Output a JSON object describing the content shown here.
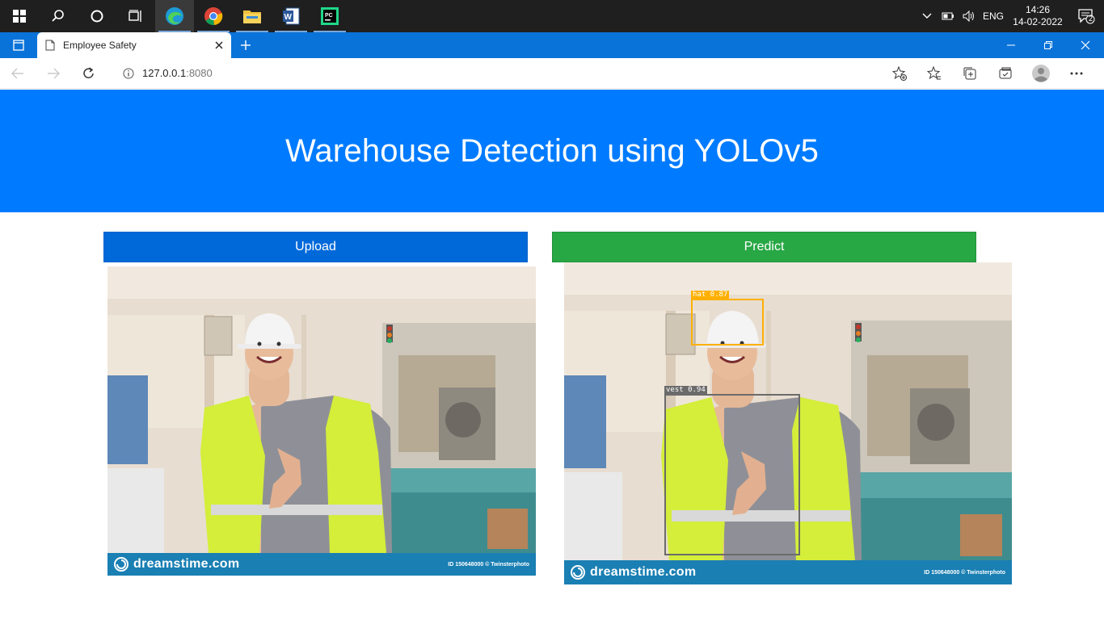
{
  "taskbar": {
    "apps": [
      "start-icon",
      "search-icon",
      "cortana-icon",
      "task-view-icon",
      "edge-icon",
      "chrome-icon",
      "file-explorer-icon",
      "word-icon",
      "pycharm-icon"
    ],
    "tray": {
      "lang": "ENG",
      "time": "14:26",
      "date": "14-02-2022",
      "notifications": "2"
    }
  },
  "browser": {
    "tab_title": "Employee Safety",
    "url_host": "127.0.0.1",
    "url_port": ":8080"
  },
  "page": {
    "title": "Warehouse Detection using YOLOv5",
    "upload_label": "Upload",
    "predict_label": "Predict",
    "watermark_site": "dreamstime.com",
    "watermark_id": "ID 150648000 © Twinsterphoto",
    "detections": [
      {
        "label": "hat 0.87",
        "color": "#ffb000"
      },
      {
        "label": "vest 0.94",
        "color": "#6b6b6b"
      }
    ]
  },
  "colors": {
    "hero": "#007bff",
    "upload": "#0069d9",
    "predict": "#28a745",
    "tabstrip": "#0a73d9"
  }
}
